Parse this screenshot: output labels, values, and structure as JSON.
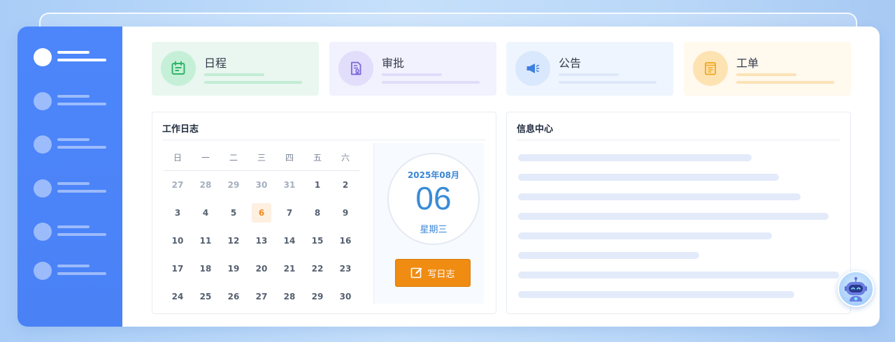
{
  "cards": [
    {
      "title": "日程",
      "bg": "#e9f7f0",
      "circle": "#c6efd7",
      "icon_color": "#2fb56a",
      "bar1": "#c3ecd4",
      "bar2": "#c3ecd4",
      "icon": "calendar-icon"
    },
    {
      "title": "审批",
      "bg": "#f2f1fe",
      "circle": "#e1ddfb",
      "icon_color": "#7b67d6",
      "bar1": "#e0dcfa",
      "bar2": "#e0dcfa",
      "icon": "approval-icon"
    },
    {
      "title": "公告",
      "bg": "#eff5fe",
      "circle": "#d9e8fc",
      "icon_color": "#3f7fe0",
      "bar1": "#dde8f8",
      "bar2": "#dde8f8",
      "icon": "megaphone-icon"
    },
    {
      "title": "工单",
      "bg": "#fff9ee",
      "circle": "#fde3b2",
      "icon_color": "#f0a51c",
      "bar1": "#fbe3b6",
      "bar2": "#fbe3b6",
      "icon": "ticket-icon"
    }
  ],
  "work_log": {
    "title": "工作日志",
    "weekdays": [
      "日",
      "一",
      "二",
      "三",
      "四",
      "五",
      "六"
    ],
    "weeks": [
      [
        {
          "d": "27",
          "m": true
        },
        {
          "d": "28",
          "m": true
        },
        {
          "d": "29",
          "m": true
        },
        {
          "d": "30",
          "m": true
        },
        {
          "d": "31",
          "m": true
        },
        {
          "d": "1"
        },
        {
          "d": "2"
        }
      ],
      [
        {
          "d": "3"
        },
        {
          "d": "4"
        },
        {
          "d": "5"
        },
        {
          "d": "6",
          "t": true
        },
        {
          "d": "7"
        },
        {
          "d": "8"
        },
        {
          "d": "9"
        }
      ],
      [
        {
          "d": "10"
        },
        {
          "d": "11"
        },
        {
          "d": "12"
        },
        {
          "d": "13"
        },
        {
          "d": "14"
        },
        {
          "d": "15"
        },
        {
          "d": "16"
        }
      ],
      [
        {
          "d": "17"
        },
        {
          "d": "18"
        },
        {
          "d": "19"
        },
        {
          "d": "20"
        },
        {
          "d": "21"
        },
        {
          "d": "22"
        },
        {
          "d": "23"
        }
      ],
      [
        {
          "d": "24"
        },
        {
          "d": "25"
        },
        {
          "d": "26"
        },
        {
          "d": "27"
        },
        {
          "d": "28"
        },
        {
          "d": "29"
        },
        {
          "d": "30"
        }
      ]
    ],
    "year_month": "2025年08月",
    "day": "06",
    "weekday": "星期三",
    "write_button": "写日志"
  },
  "info_center": {
    "title": "信息中心",
    "placeholder_line_count": 8
  },
  "colors": {
    "accent_blue": "#4d86fb",
    "button_orange": "#f08c12",
    "today_orange": "#ef8a1c"
  }
}
